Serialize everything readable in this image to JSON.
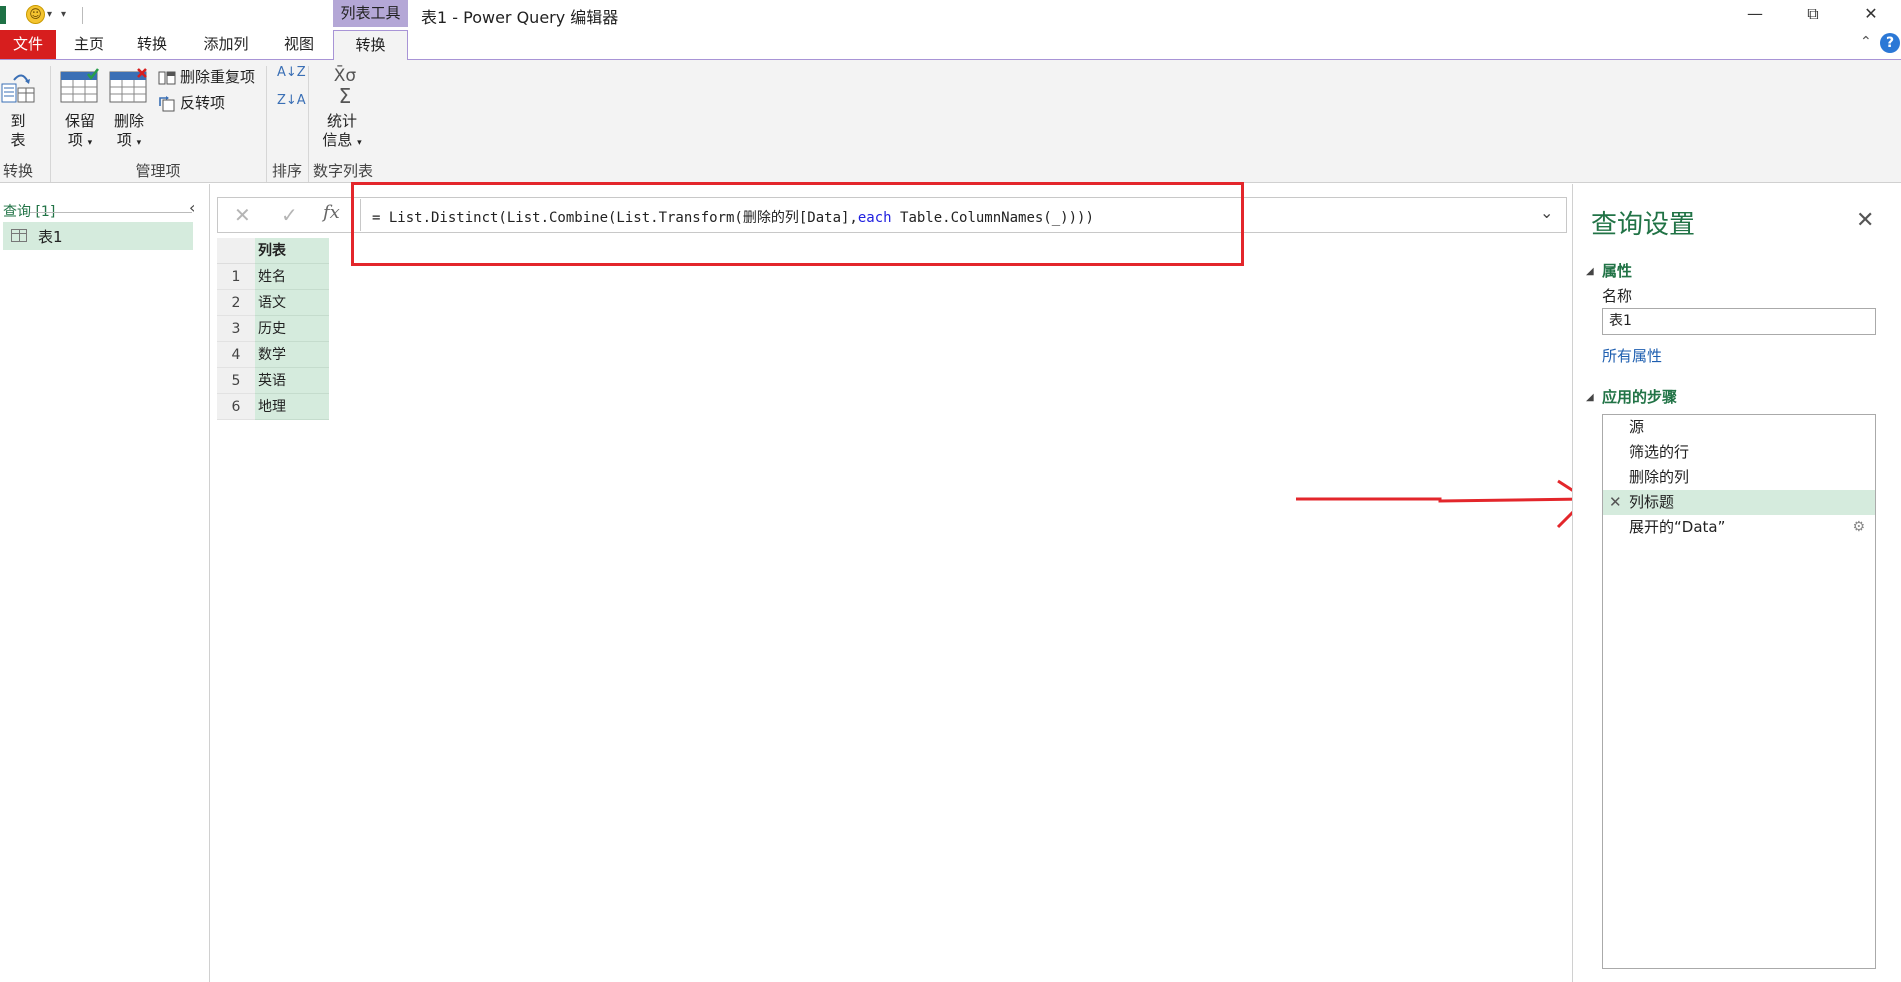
{
  "title_bar": {
    "doc_title": "表1 - Power Query 编辑器",
    "context_tab_header": "列表工具",
    "minimize_glyph": "—",
    "restore_glyph": "⧉",
    "close_glyph": "✕",
    "smiley_glyph": "☺",
    "dropdown_glyph": "▾"
  },
  "tabs": {
    "file": "文件",
    "home": "主页",
    "transform": "转换",
    "add_column": "添加列",
    "view": "视图",
    "active_transform": "转换",
    "help_glyph": "?",
    "collapse_glyph": "⌃"
  },
  "ribbon": {
    "to_table": {
      "line1": "到",
      "line2": "表"
    },
    "keep_items": {
      "line1": "保留",
      "line2": "项"
    },
    "remove_items": {
      "line1": "删除",
      "line2": "项"
    },
    "remove_duplicates": "删除重复项",
    "reverse_items": "反转项",
    "statistics": {
      "line1": "统计",
      "line2": "信息"
    },
    "stats_symbols": "X̄σ",
    "sigma": "Σ",
    "sort_asc_glyph": "A↓Z",
    "sort_desc_glyph": "Z↓A",
    "group_convert": "转换",
    "group_manage": "管理项",
    "group_sort": "排序",
    "group_numeric": "数字列表"
  },
  "queries": {
    "header": "查询 [1]",
    "collapse_glyph": "‹",
    "items": [
      {
        "label": "表1"
      }
    ]
  },
  "formula_bar": {
    "cancel_glyph": "✕",
    "commit_glyph": "✓",
    "fx": "fx",
    "formula_prefix": "= List.Distinct(List.Combine(List.Transform(删除的列[Data],",
    "formula_keyword": "each",
    "formula_suffix": " Table.ColumnNames(_))))",
    "dropdown_glyph": "⌄"
  },
  "grid": {
    "column_header": "列表",
    "rows": [
      {
        "n": "1",
        "value": "姓名"
      },
      {
        "n": "2",
        "value": "语文"
      },
      {
        "n": "3",
        "value": "历史"
      },
      {
        "n": "4",
        "value": "数学"
      },
      {
        "n": "5",
        "value": "英语"
      },
      {
        "n": "6",
        "value": "地理"
      }
    ]
  },
  "settings": {
    "title": "查询设置",
    "close_glyph": "✕",
    "properties_title": "属性",
    "name_label": "名称",
    "name_value": "表1",
    "all_properties": "所有属性",
    "applied_steps_title": "应用的步骤",
    "collapse_tri": "◢",
    "steps": [
      {
        "label": "源"
      },
      {
        "label": "筛选的行"
      },
      {
        "label": "删除的列"
      },
      {
        "label": "列标题",
        "selected": true
      },
      {
        "label": "展开的“Data”",
        "has_gear": true
      }
    ],
    "delete_glyph": "✕",
    "gear_glyph": "⚙"
  },
  "colors": {
    "accent_green": "#217346",
    "selection_green": "#d5ebdd",
    "file_tab_red": "#d71e1e",
    "context_purple": "#b4a7d6",
    "annotation_red": "#e3262b",
    "keyword_blue": "#2020e0"
  }
}
